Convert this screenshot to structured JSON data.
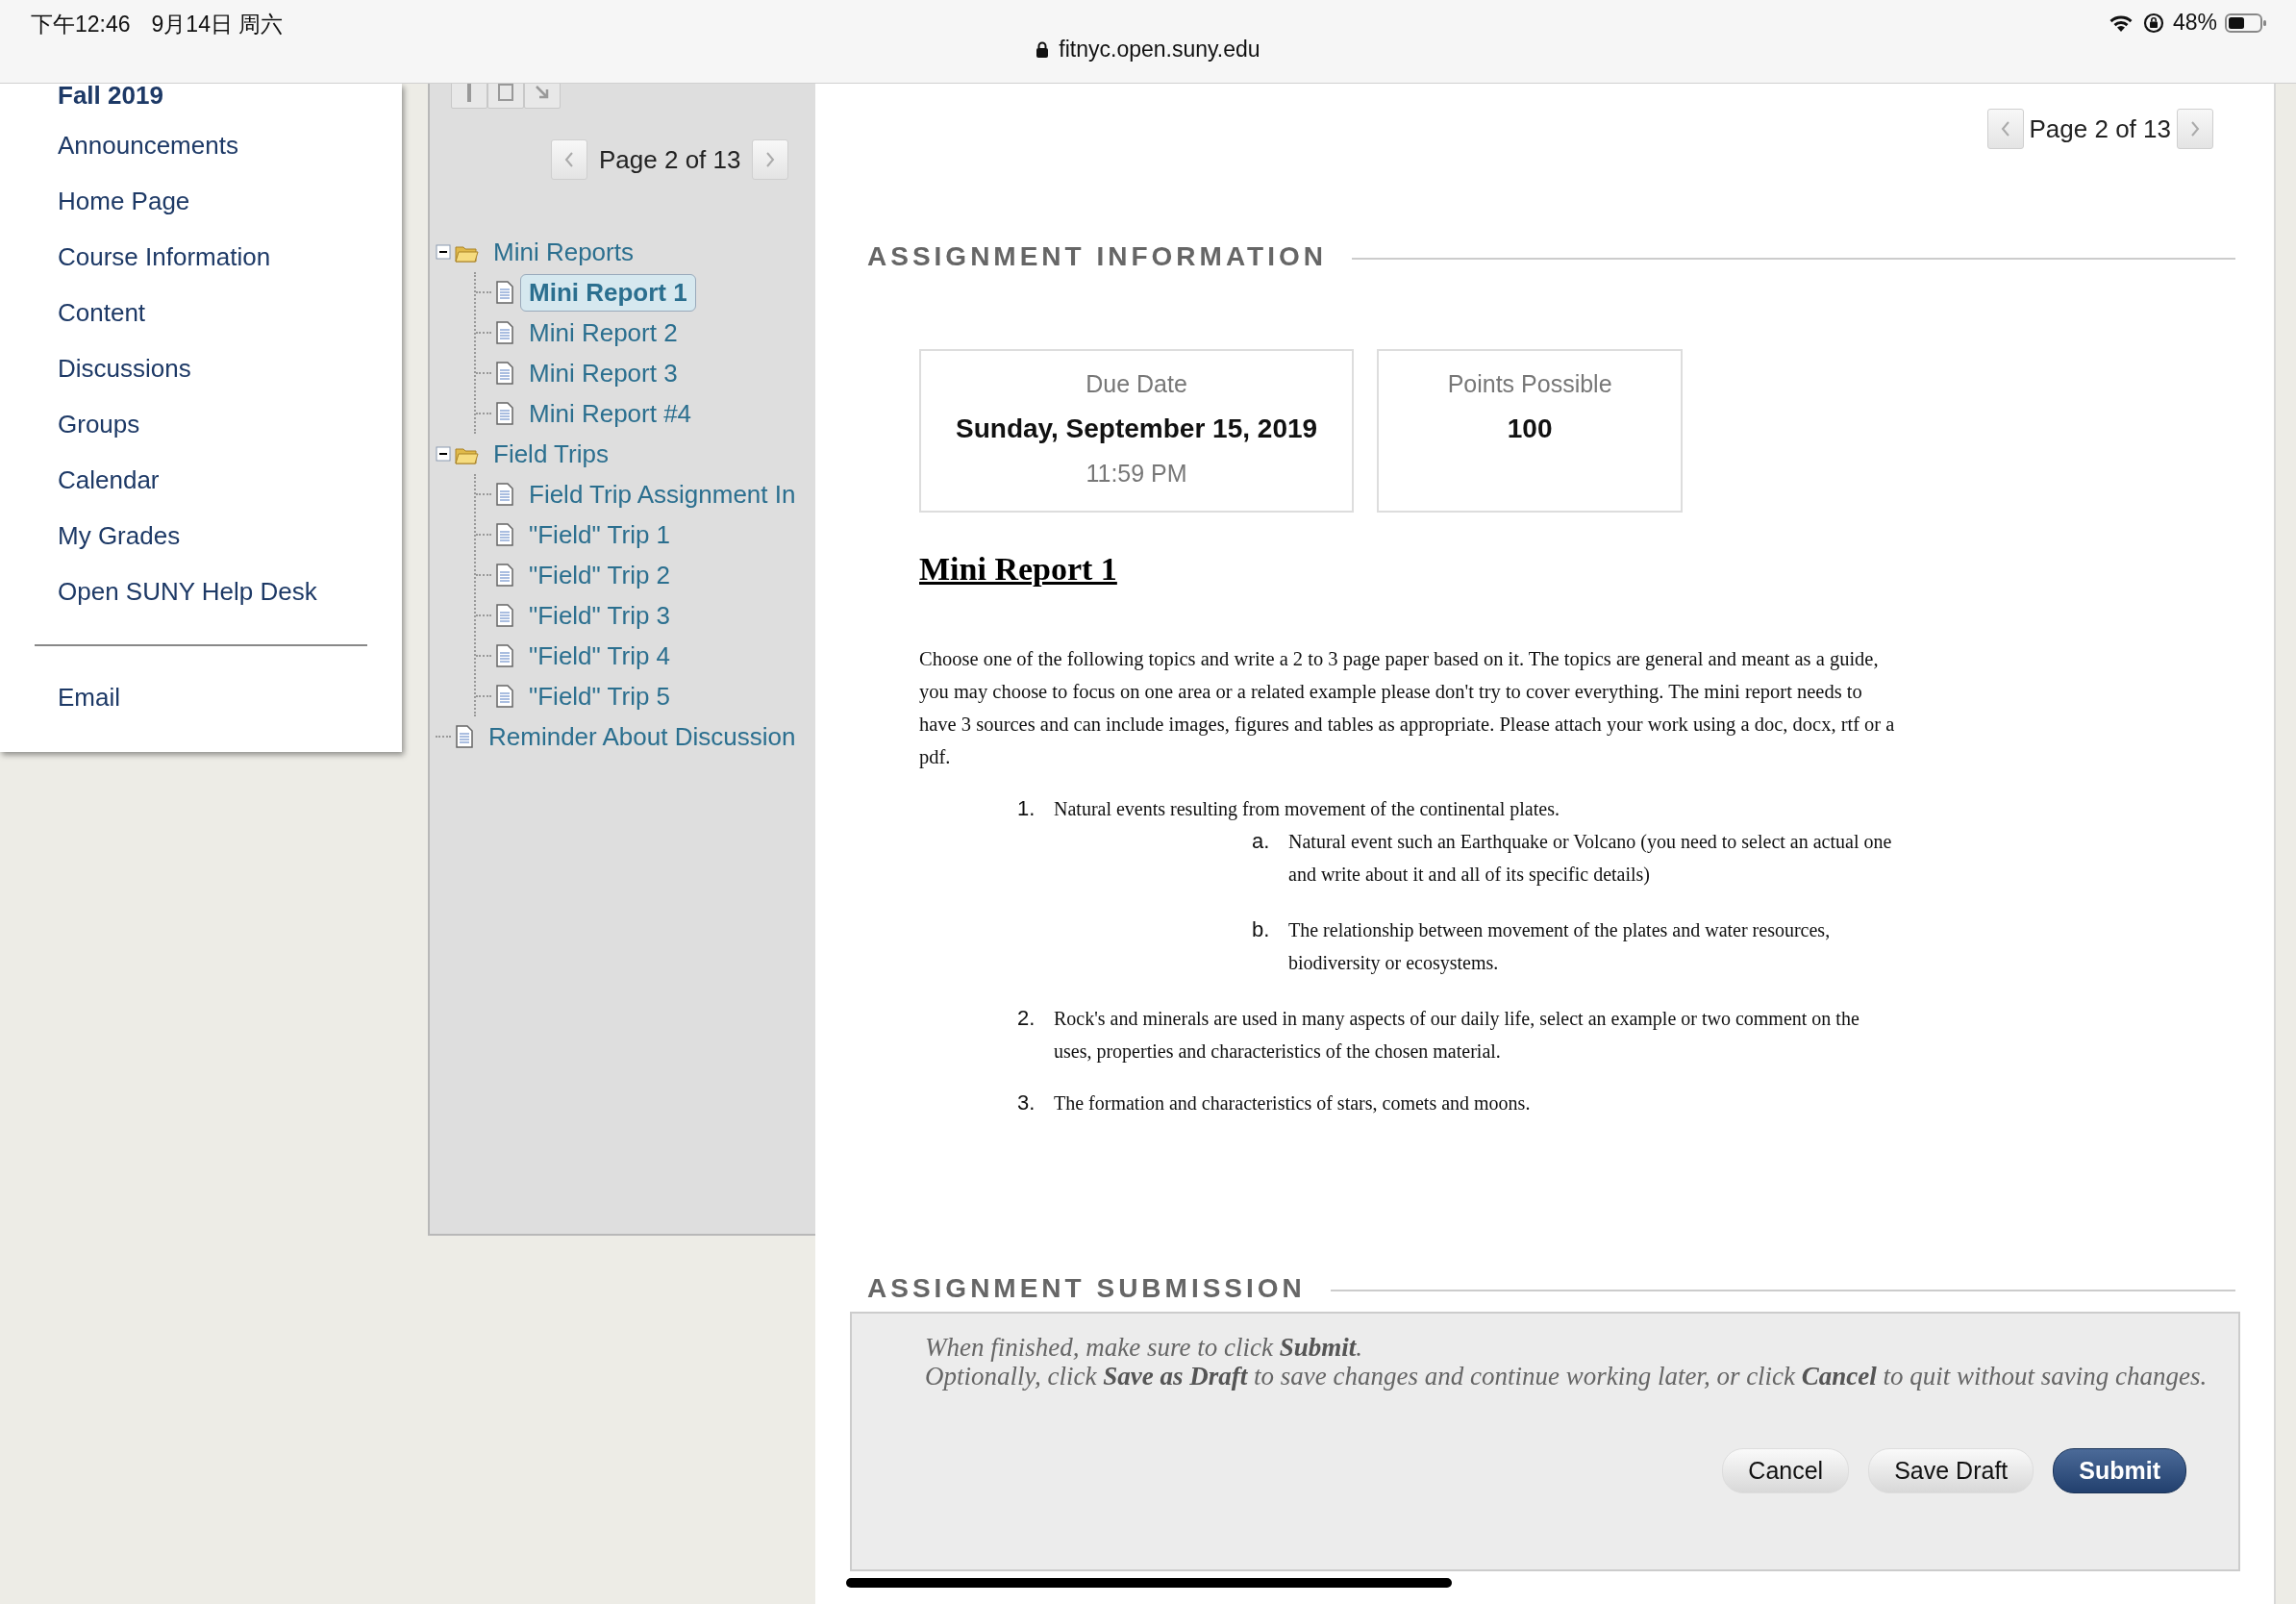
{
  "status_bar": {
    "time": "下午12:46",
    "date": "9月14日 周六",
    "url": "fitnyc.open.suny.edu",
    "battery": "48%"
  },
  "left_menu": {
    "course": "Fall 2019",
    "items": [
      {
        "label": "Announcements"
      },
      {
        "label": "Home Page"
      },
      {
        "label": "Course Information"
      },
      {
        "label": "Content"
      },
      {
        "label": "Discussions"
      },
      {
        "label": "Groups"
      },
      {
        "label": "Calendar"
      },
      {
        "label": "My Grades"
      },
      {
        "label": "Open SUNY Help Desk"
      }
    ],
    "footer_items": [
      {
        "label": "Email"
      }
    ]
  },
  "tree_panel": {
    "pager": {
      "label": "Page 2 of 13"
    },
    "tree": [
      {
        "label": "Mini Reports",
        "kind": "folder",
        "expanded": true,
        "children": [
          {
            "label": "Mini Report 1",
            "kind": "document",
            "selected": true
          },
          {
            "label": "Mini Report 2",
            "kind": "document",
            "selected": false
          },
          {
            "label": "Mini Report 3",
            "kind": "document",
            "selected": false
          },
          {
            "label": "Mini Report #4",
            "kind": "document",
            "selected": false
          }
        ]
      },
      {
        "label": "Field Trips",
        "kind": "folder",
        "expanded": true,
        "children": [
          {
            "label": "Field Trip Assignment In",
            "kind": "document",
            "selected": false
          },
          {
            "label": "\"Field\" Trip 1",
            "kind": "document",
            "selected": false
          },
          {
            "label": "\"Field\" Trip 2",
            "kind": "document",
            "selected": false
          },
          {
            "label": "\"Field\" Trip 3",
            "kind": "document",
            "selected": false
          },
          {
            "label": "\"Field\" Trip 4",
            "kind": "document",
            "selected": false
          },
          {
            "label": "\"Field\" Trip 5",
            "kind": "document",
            "selected": false
          }
        ]
      },
      {
        "label": "Reminder About Discussion",
        "kind": "document",
        "selected": false
      }
    ]
  },
  "content": {
    "pager": {
      "label": "Page 2 of 13"
    },
    "info_section": {
      "title": "ASSIGNMENT INFORMATION",
      "cards": [
        {
          "label": "Due Date",
          "value": "Sunday, September 15, 2019",
          "detail": "11:59 PM"
        },
        {
          "label": "Points Possible",
          "value": "100"
        }
      ]
    },
    "assignment": {
      "title": "Mini Report 1",
      "intro": "Choose one of the following topics and write a 2 to 3 page paper based on it. The topics are general and meant as a guide, you may choose to focus on one area or a related example please don't try to cover everything. The mini report needs to have 3 sources and can include images, figures and tables as appropriate.  Please attach your work using a doc, docx, rtf or a pdf.",
      "topics": [
        {
          "marker": "1.",
          "text": "Natural events resulting from movement of the continental plates.",
          "subtopics": [
            {
              "marker": "a.",
              "text": "Natural event such an Earthquake or Volcano (you need to select an actual one and write about it and all of its specific details)"
            },
            {
              "marker": "b.",
              "text": "The relationship between movement of the plates and water resources, biodiversity or ecosystems."
            }
          ]
        },
        {
          "marker": "2.",
          "text": "Rock's and minerals are used in many aspects of our daily life, select an example or two comment on the uses, properties and characteristics of the chosen material."
        },
        {
          "marker": "3.",
          "text": "The formation and characteristics of stars, comets and moons."
        }
      ]
    },
    "submission": {
      "title": "ASSIGNMENT SUBMISSION",
      "instructions": [
        "When finished, make sure to click **Submit**.",
        "Optionally, click **Save as Draft** to save changes and continue working later, or click **Cancel** to quit without saving changes."
      ],
      "buttons": [
        {
          "label": "Cancel",
          "kind": "default"
        },
        {
          "label": "Save Draft",
          "kind": "default"
        },
        {
          "label": "Submit",
          "kind": "primary"
        }
      ]
    }
  }
}
